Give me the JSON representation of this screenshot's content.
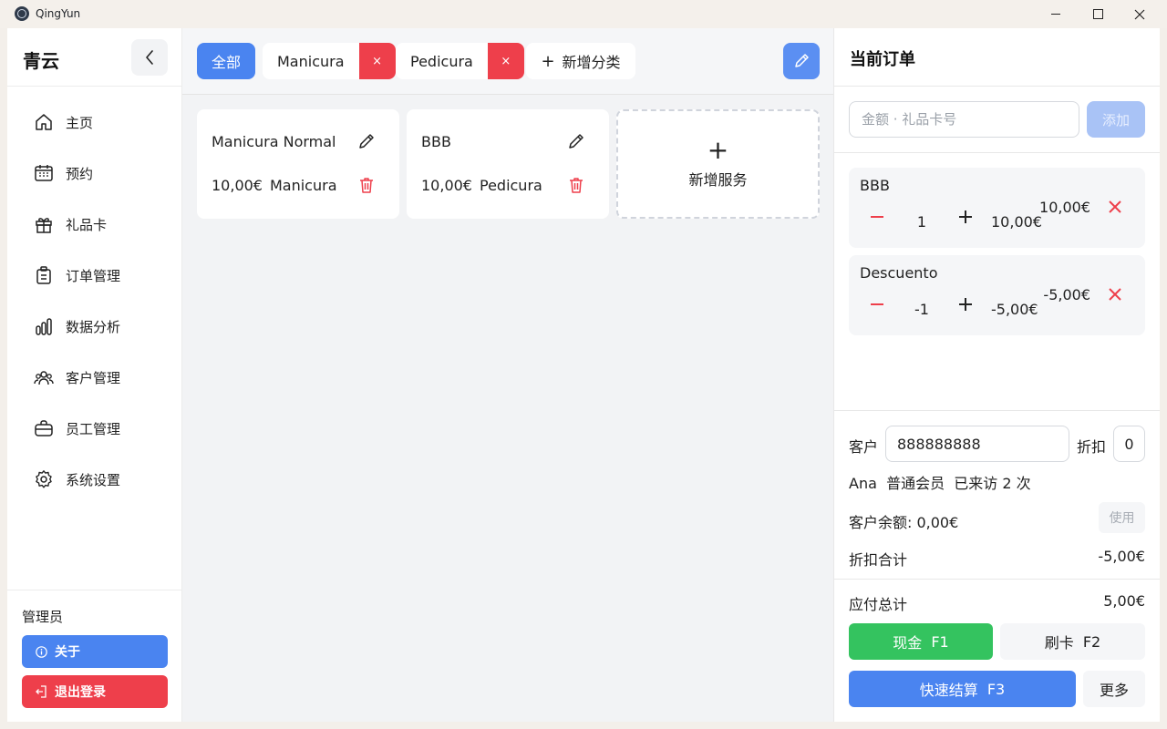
{
  "window": {
    "title": "QingYun"
  },
  "sidebar": {
    "brand": "青云",
    "items": [
      {
        "label": "主页",
        "icon": "home-icon"
      },
      {
        "label": "预约",
        "icon": "calendar-icon"
      },
      {
        "label": "礼品卡",
        "icon": "gift-icon"
      },
      {
        "label": "订单管理",
        "icon": "clipboard-icon"
      },
      {
        "label": "数据分析",
        "icon": "bar-chart-icon"
      },
      {
        "label": "客户管理",
        "icon": "users-icon"
      },
      {
        "label": "员工管理",
        "icon": "briefcase-icon"
      },
      {
        "label": "系统设置",
        "icon": "gear-icon"
      }
    ],
    "user_role": "管理员",
    "about_label": "关于",
    "logout_label": "退出登录"
  },
  "categories": {
    "all_label": "全部",
    "items": [
      {
        "name": "Manicura",
        "remove": "×"
      },
      {
        "name": "Pedicura",
        "remove": "×"
      }
    ],
    "add_label": "新增分类",
    "add_plus": "+"
  },
  "services": {
    "items": [
      {
        "name": "Manicura Normal",
        "price": "10,00€",
        "category": "Manicura"
      },
      {
        "name": "BBB",
        "price": "10,00€",
        "category": "Pedicura"
      }
    ],
    "add_plus": "+",
    "add_label": "新增服务"
  },
  "order": {
    "title": "当前订单",
    "gift_placeholder": "金额 · 礼品卡号",
    "add_button": "添加",
    "lines": [
      {
        "name": "BBB",
        "qty": "1",
        "unit": "10,00€",
        "total": "10,00€"
      },
      {
        "name": "Descuento",
        "qty": "-1",
        "unit": "-5,00€",
        "total": "-5,00€"
      }
    ],
    "customer_label": "客户",
    "customer_value": "888888888",
    "discount_label": "折扣",
    "discount_value": "0",
    "customer_name": "Ana",
    "customer_level": "普通会员",
    "customer_visits": "已来访 2 次",
    "balance_label": "客户余额: 0,00€",
    "use_button": "使用",
    "discount_total_label": "折扣合计",
    "discount_total_value": "-5,00€",
    "due_label": "应付总计",
    "due_value": "5,00€",
    "cash_label": "现金",
    "cash_key": "F1",
    "card_label": "刷卡",
    "card_key": "F2",
    "quick_label": "快速结算",
    "quick_key": "F3",
    "more_label": "更多"
  },
  "colors": {
    "primary": "#4a84f0",
    "danger": "#ee3f4b",
    "success": "#34c35f"
  }
}
